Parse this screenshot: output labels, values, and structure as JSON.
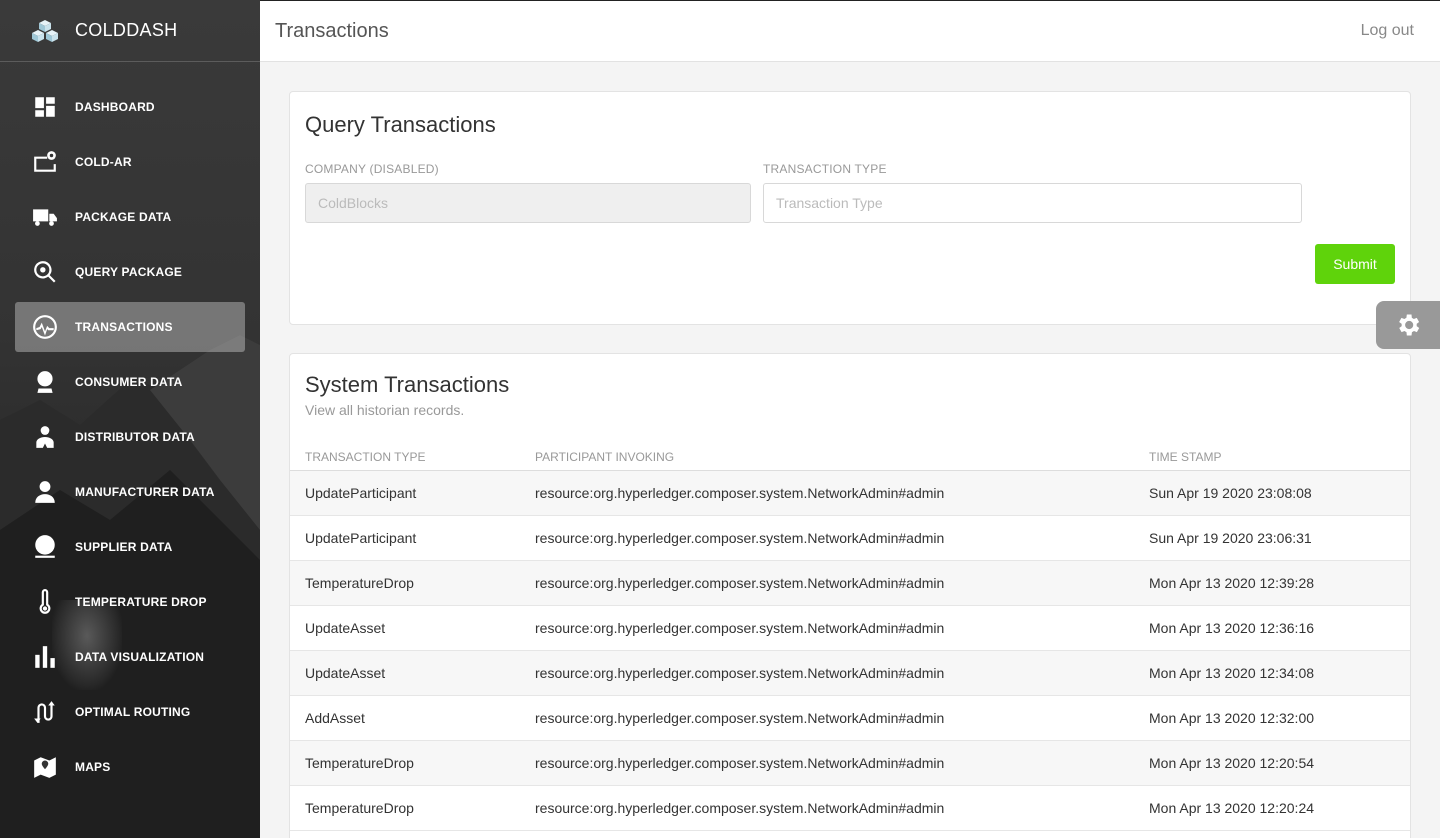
{
  "app": {
    "title": "COLDDASH"
  },
  "header": {
    "title": "Transactions",
    "logout_label": "Log out"
  },
  "sidebar": {
    "items": [
      {
        "label": "DASHBOARD",
        "icon": "dashboard-icon"
      },
      {
        "label": "COLD-AR",
        "icon": "cold-ar-icon"
      },
      {
        "label": "PACKAGE DATA",
        "icon": "truck-icon"
      },
      {
        "label": "QUERY PACKAGE",
        "icon": "search-icon"
      },
      {
        "label": "TRANSACTIONS",
        "icon": "activity-icon",
        "active": true
      },
      {
        "label": "CONSUMER DATA",
        "icon": "consumer-icon"
      },
      {
        "label": "DISTRIBUTOR DATA",
        "icon": "distributor-icon"
      },
      {
        "label": "MANUFACTURER DATA",
        "icon": "person-icon"
      },
      {
        "label": "SUPPLIER DATA",
        "icon": "supplier-icon"
      },
      {
        "label": "TEMPERATURE DROP",
        "icon": "thermometer-icon"
      },
      {
        "label": "DATA VISUALIZATION",
        "icon": "bar-chart-icon"
      },
      {
        "label": "OPTIMAL ROUTING",
        "icon": "routing-icon"
      },
      {
        "label": "MAPS",
        "icon": "map-icon"
      }
    ]
  },
  "query": {
    "title": "Query Transactions",
    "company_label": "COMPANY (DISABLED)",
    "company_value": "ColdBlocks",
    "type_label": "TRANSACTION TYPE",
    "type_placeholder": "Transaction Type",
    "submit_label": "Submit"
  },
  "system": {
    "title": "System Transactions",
    "subtitle": "View all historian records.",
    "columns": [
      "TRANSACTION TYPE",
      "PARTICIPANT INVOKING",
      "TIME STAMP"
    ],
    "rows": [
      [
        "UpdateParticipant",
        "resource:org.hyperledger.composer.system.NetworkAdmin#admin",
        "Sun Apr 19 2020 23:08:08"
      ],
      [
        "UpdateParticipant",
        "resource:org.hyperledger.composer.system.NetworkAdmin#admin",
        "Sun Apr 19 2020 23:06:31"
      ],
      [
        "TemperatureDrop",
        "resource:org.hyperledger.composer.system.NetworkAdmin#admin",
        "Mon Apr 13 2020 12:39:28"
      ],
      [
        "UpdateAsset",
        "resource:org.hyperledger.composer.system.NetworkAdmin#admin",
        "Mon Apr 13 2020 12:36:16"
      ],
      [
        "UpdateAsset",
        "resource:org.hyperledger.composer.system.NetworkAdmin#admin",
        "Mon Apr 13 2020 12:34:08"
      ],
      [
        "AddAsset",
        "resource:org.hyperledger.composer.system.NetworkAdmin#admin",
        "Mon Apr 13 2020 12:32:00"
      ],
      [
        "TemperatureDrop",
        "resource:org.hyperledger.composer.system.NetworkAdmin#admin",
        "Mon Apr 13 2020 12:20:54"
      ],
      [
        "TemperatureDrop",
        "resource:org.hyperledger.composer.system.NetworkAdmin#admin",
        "Mon Apr 13 2020 12:20:24"
      ]
    ]
  },
  "colors": {
    "accent": "#5fd30b",
    "sidebar_active": "#8a8a8a",
    "settings_fab": "#999999"
  }
}
